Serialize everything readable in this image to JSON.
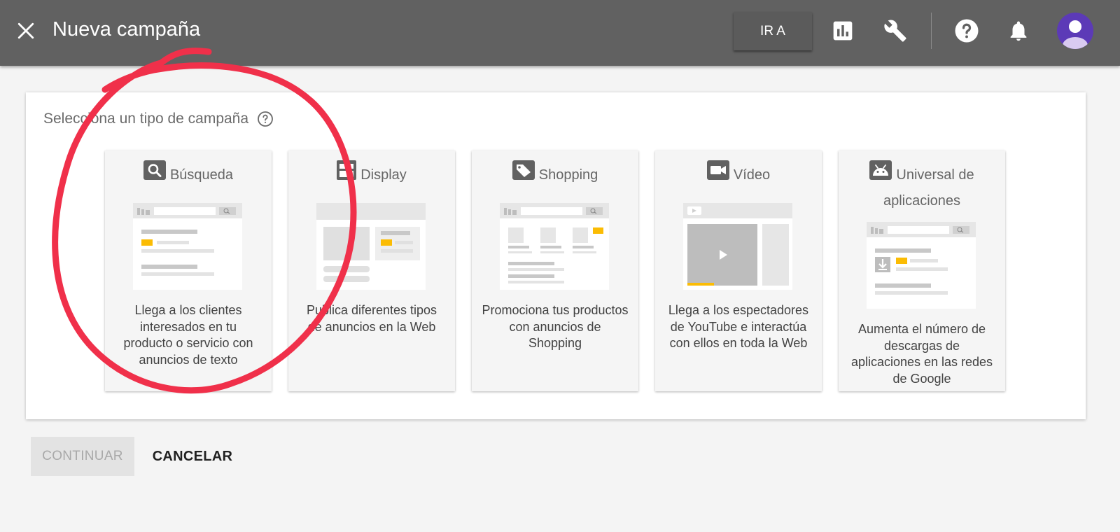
{
  "header": {
    "title": "Nueva campaña",
    "goto_label": "IR A",
    "icons": [
      "close-icon",
      "reports-icon",
      "tools-icon",
      "help-icon",
      "notifications-icon",
      "account-avatar"
    ]
  },
  "panel": {
    "heading": "Selecciona un tipo de campaña",
    "campaign_types": [
      {
        "icon": "search-icon",
        "title": "Búsqueda",
        "description": "Llega a los clientes interesados en tu producto o servicio con anuncios de texto"
      },
      {
        "icon": "display-icon",
        "title": "Display",
        "description": "Publica diferentes tipos de anuncios en la Web"
      },
      {
        "icon": "shopping-tag-icon",
        "title": "Shopping",
        "description": "Promociona tus productos con anuncios de Shopping"
      },
      {
        "icon": "video-camera-icon",
        "title": "Vídeo",
        "description": "Llega a los espectadores de YouTube e interactúa con ellos en toda la Web"
      },
      {
        "icon": "android-app-icon",
        "title": "Universal de aplicaciones",
        "description": "Aumenta el número de descargas de aplicaciones en las redes de Google"
      }
    ]
  },
  "actions": {
    "continue_label": "CONTINUAR",
    "cancel_label": "CANCELAR"
  },
  "colors": {
    "topbar": "#616161",
    "accent_yellow": "#fbbc04",
    "annotation_red": "#f0304a",
    "avatar": "#5c3ab7"
  }
}
